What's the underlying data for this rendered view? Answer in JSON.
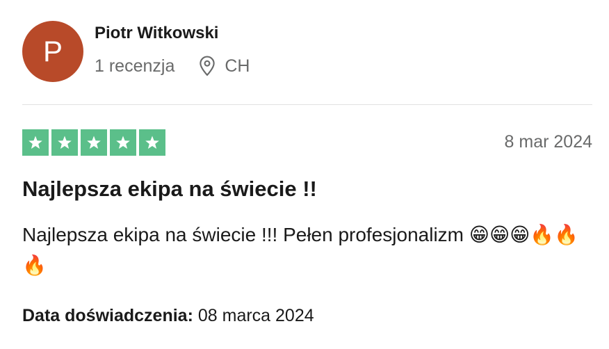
{
  "reviewer": {
    "initial": "P",
    "name": "Piotr Witkowski",
    "review_count": "1 recenzja",
    "country": "CH",
    "avatar_color": "#b84a29"
  },
  "review": {
    "rating": 5,
    "max_rating": 5,
    "star_color": "#5bbf8a",
    "date": "8 mar 2024",
    "title": "Najlepsza ekipa na świecie !!",
    "body": "Najlepsza ekipa na świecie !!! Pełen profesjonalizm 😁😁😁🔥🔥🔥",
    "experience_label": "Data doświadczenia:",
    "experience_date": "08 marca 2024"
  },
  "icons": {
    "location": "map-pin-icon",
    "star": "star-icon"
  }
}
